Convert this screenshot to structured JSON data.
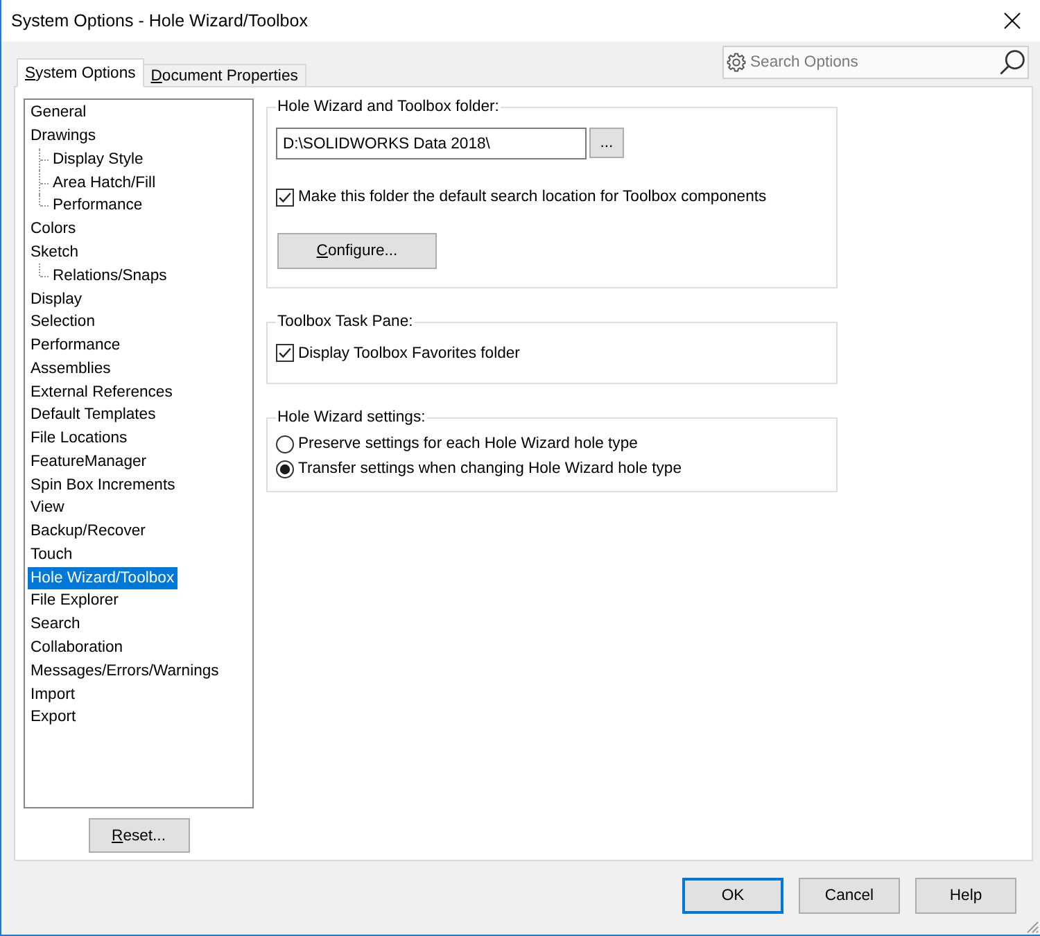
{
  "window": {
    "title": "System Options - Hole Wizard/Toolbox"
  },
  "tabs": [
    {
      "label": "System Options",
      "selected": true,
      "mnemonic": true
    },
    {
      "label": "Document Properties",
      "selected": false,
      "mnemonic": true
    }
  ],
  "search": {
    "placeholder": "Search Options"
  },
  "tree": {
    "items": [
      {
        "label": "General",
        "selected": false
      },
      {
        "label": "Drawings",
        "selected": false,
        "children": [
          {
            "label": "Display Style",
            "selected": false
          },
          {
            "label": "Area Hatch/Fill",
            "selected": false
          },
          {
            "label": "Performance",
            "selected": false
          }
        ]
      },
      {
        "label": "Colors",
        "selected": false
      },
      {
        "label": "Sketch",
        "selected": false,
        "children": [
          {
            "label": "Relations/Snaps",
            "selected": false
          }
        ]
      },
      {
        "label": "Display",
        "selected": false
      },
      {
        "label": "Selection",
        "selected": false
      },
      {
        "label": "Performance",
        "selected": false
      },
      {
        "label": "Assemblies",
        "selected": false
      },
      {
        "label": "External References",
        "selected": false
      },
      {
        "label": "Default Templates",
        "selected": false
      },
      {
        "label": "File Locations",
        "selected": false
      },
      {
        "label": "FeatureManager",
        "selected": false
      },
      {
        "label": "Spin Box Increments",
        "selected": false
      },
      {
        "label": "View",
        "selected": false
      },
      {
        "label": "Backup/Recover",
        "selected": false
      },
      {
        "label": "Touch",
        "selected": false
      },
      {
        "label": "Hole Wizard/Toolbox",
        "selected": true
      },
      {
        "label": "File Explorer",
        "selected": false
      },
      {
        "label": "Search",
        "selected": false
      },
      {
        "label": "Collaboration",
        "selected": false
      },
      {
        "label": "Messages/Errors/Warnings",
        "selected": false
      },
      {
        "label": "Import",
        "selected": false
      },
      {
        "label": "Export",
        "selected": false
      }
    ]
  },
  "reset_button": {
    "label": "Reset...",
    "mnemonic": true
  },
  "groups": [
    {
      "title": "Hole Wizard and Toolbox folder:",
      "controls": [
        {
          "kind": "path",
          "value": "D:\\SOLIDWORKS Data 2018\\",
          "browse_label": "..."
        },
        {
          "kind": "checkbox",
          "label": "Make this folder the default search location for Toolbox components",
          "checked": true
        },
        {
          "kind": "button",
          "label": "Configure...",
          "mnemonic": true
        }
      ]
    },
    {
      "title": "Toolbox Task Pane:",
      "controls": [
        {
          "kind": "checkbox",
          "label": "Display Toolbox Favorites folder",
          "checked": true
        }
      ]
    },
    {
      "title": "Hole Wizard settings:",
      "controls": [
        {
          "kind": "radio",
          "label": "Preserve settings for each Hole Wizard hole type",
          "selected": false
        },
        {
          "kind": "radio",
          "label": "Transfer settings when changing Hole Wizard hole type",
          "selected": true
        }
      ]
    }
  ],
  "buttons": [
    {
      "label": "OK",
      "default": true
    },
    {
      "label": "Cancel",
      "default": false
    },
    {
      "label": "Help",
      "default": false
    }
  ]
}
